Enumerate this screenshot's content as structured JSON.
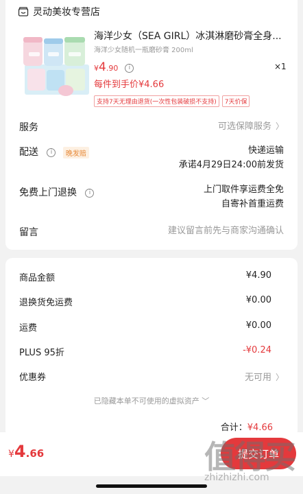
{
  "store": {
    "name": "灵动美妆专营店",
    "icon": "store-icon"
  },
  "product": {
    "title": "海洋少女（SEA GIRL）冰淇淋磨砂膏全身...",
    "subtitle": "海洋少女随机一瓶磨砂膏 200ml",
    "price_yen": "¥",
    "price_int": "4",
    "price_dec": ".90",
    "quantity": "×1",
    "unit_price": "每件到手价¥4.66",
    "tags": [
      "支持7天无理由退货(一次性包装破损不支持)",
      "7天价保"
    ]
  },
  "rows": {
    "service": {
      "label": "服务",
      "value": "可选保障服务"
    },
    "delivery": {
      "label": "配送",
      "badge": "晚发赔",
      "value1": "快递运输",
      "value2": "承诺4月29日24:00前发货"
    },
    "pickup": {
      "label": "免费上门退换",
      "value1": "上门取件享运费全免",
      "value2": "自寄补首重运费"
    },
    "note": {
      "label": "留言",
      "value": "建议留言前先与商家沟通确认"
    }
  },
  "fees": {
    "goods": {
      "label": "商品金额",
      "value": "¥4.90"
    },
    "return": {
      "label": "退换货免运费",
      "value": "¥0.00"
    },
    "shipping": {
      "label": "运费",
      "value": "¥0.00"
    },
    "plus": {
      "label": "PLUS 95折",
      "value": "-¥0.24"
    },
    "coupon": {
      "label": "优惠券",
      "value": "无可用"
    }
  },
  "hidden_note": "已隐藏本单不可使用的虚拟资产 ﹀",
  "total": {
    "label": "合计：",
    "amount": "¥4.66"
  },
  "bottom": {
    "yen": "¥",
    "int": "4",
    "dec": ".66",
    "submit": "提交订单"
  },
  "watermark": {
    "logo": "值得买",
    "url": "zhizhizhi.com"
  },
  "colors": {
    "accent": "#e4393c",
    "badge": "#e78a3a"
  }
}
